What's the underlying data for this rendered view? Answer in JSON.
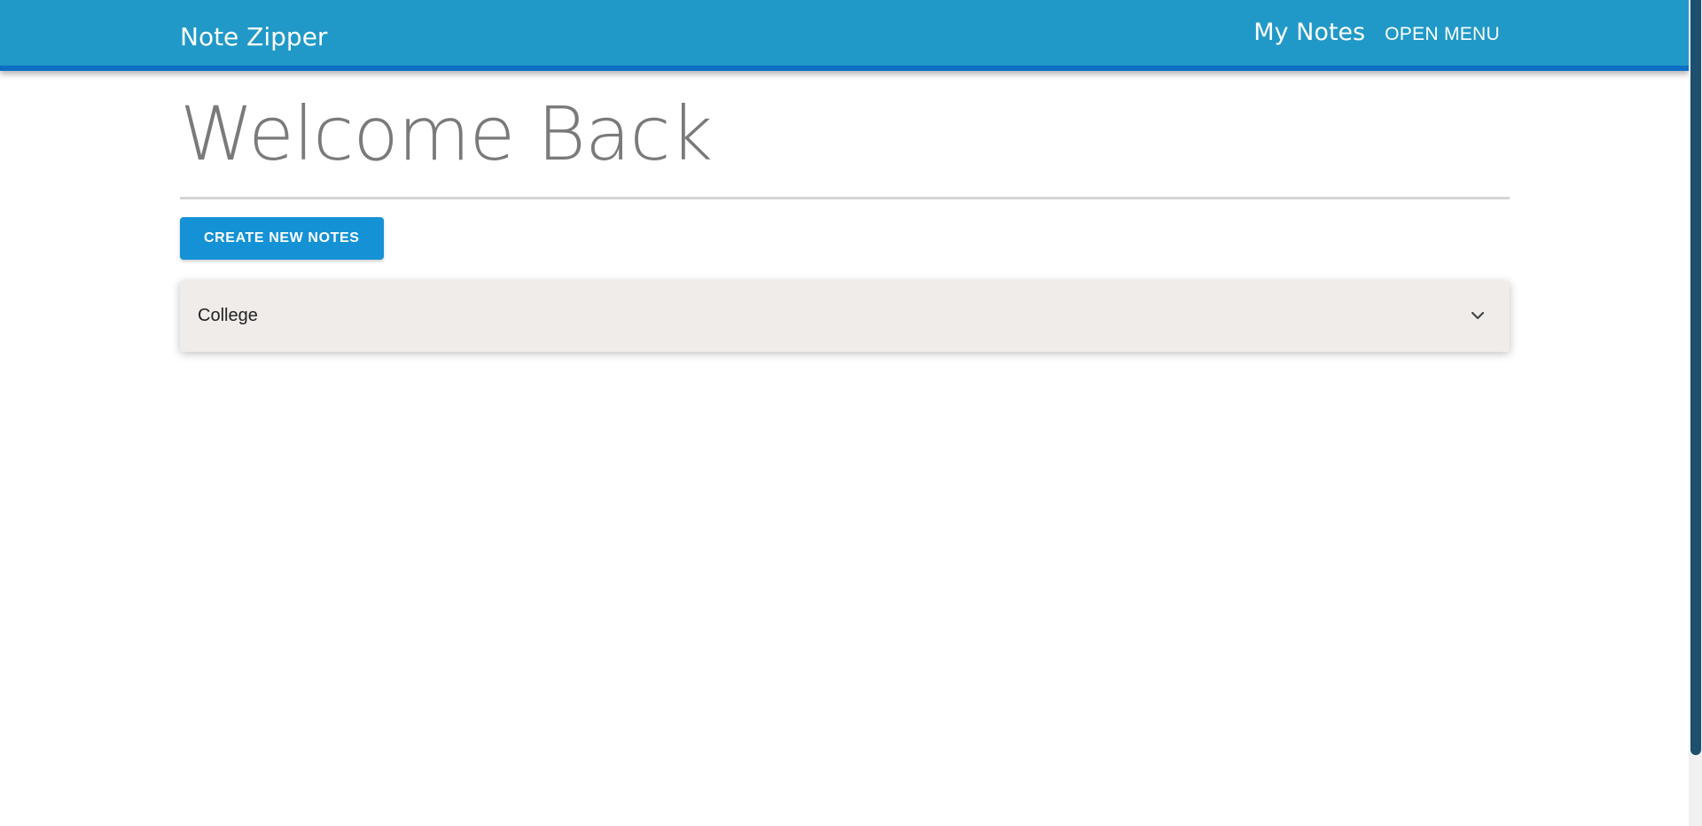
{
  "navbar": {
    "brand": "Note Zipper",
    "my_notes": "My Notes",
    "open_menu": "OPEN MENU"
  },
  "main": {
    "title": "Welcome Back",
    "create_button": "CREATE NEW NOTES",
    "notes": [
      {
        "title": "College",
        "expanded": false
      }
    ]
  },
  "colors": {
    "navbar_bg": "#2199c8",
    "navbar_border": "#0d6fc4",
    "button_bg": "#1591d6",
    "accordion_bg": "#f0ecea",
    "title_text": "#7a7a7a"
  },
  "icons": {
    "accordion_toggle": "chevron-down-icon"
  }
}
